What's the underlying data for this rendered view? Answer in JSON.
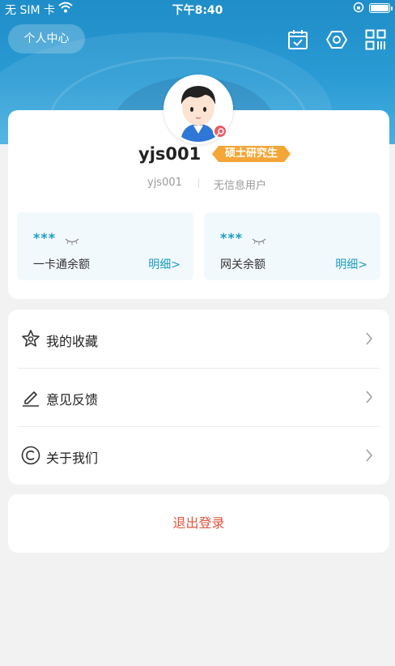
{
  "status_bar": {
    "carrier": "无 SIM 卡",
    "time": "下午8:40"
  },
  "header": {
    "personal_center_label": "个人中心",
    "icons": [
      "calendar-check-icon",
      "settings-hexagon-icon",
      "qrcode-scan-icon"
    ]
  },
  "profile": {
    "username": "yjs001",
    "role": "硕士研究生",
    "id": "yjs001",
    "user_type": "无信息用户"
  },
  "balances": [
    {
      "masked_value": "***",
      "label": "一卡通余额",
      "detail": "明细>"
    },
    {
      "masked_value": "***",
      "label": "网关余额",
      "detail": "明细>"
    }
  ],
  "menu": [
    {
      "label": "我的收藏",
      "icon": "star-icon"
    },
    {
      "label": "意见反馈",
      "icon": "edit-pen-icon"
    },
    {
      "label": "关于我们",
      "icon": "copyright-icon"
    }
  ],
  "logout_label": "退出登录",
  "colors": {
    "accent": "#1a9cc0",
    "header_blue": "#2a9bd4",
    "role_tag": "#f4a637",
    "logout": "#e0533d"
  }
}
